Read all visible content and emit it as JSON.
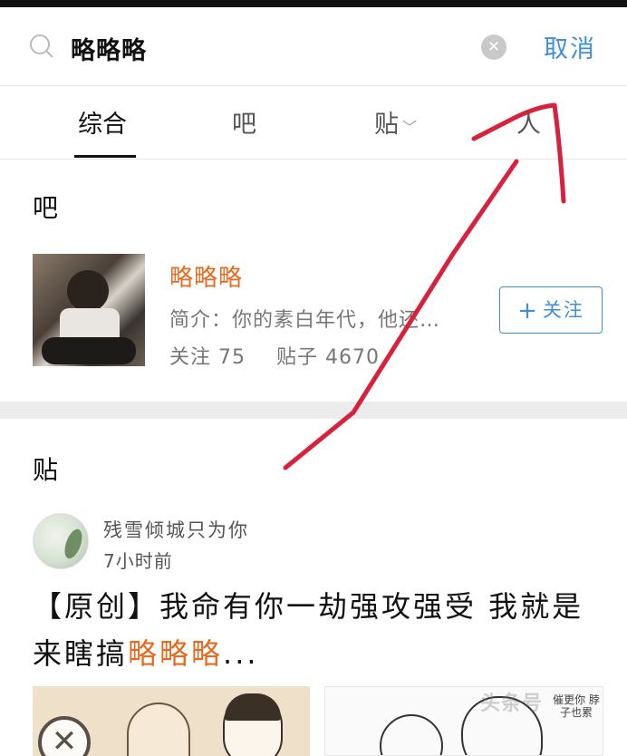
{
  "search": {
    "query": "略略略",
    "cancel_label": "取消"
  },
  "tabs": [
    {
      "label": "综合",
      "active": true
    },
    {
      "label": "吧",
      "active": false
    },
    {
      "label": "贴",
      "active": false
    },
    {
      "label": "人",
      "active": false
    }
  ],
  "ba_section": {
    "title": "吧",
    "forum": {
      "name": "略略略",
      "intro": "简介：你的素白年代，他还…",
      "followers_label": "关注 75",
      "posts_label": "贴子 4670",
      "follow_button": "关注"
    }
  },
  "post_section": {
    "title": "贴",
    "post": {
      "author": "残雪倾城只为你",
      "time": "7小时前",
      "title_prefix": "【原创】我命有你一劫强攻强受 我就是来瞎搞",
      "title_highlight": "略略略",
      "title_suffix": "...",
      "thumb2_caption": "催更你 脖子也累"
    }
  },
  "watermark": "头条号",
  "colors": {
    "accent_blue": "#3d8fdb",
    "highlight_orange": "#e56a1f",
    "annotation_red": "#d8213c"
  },
  "icons": [
    "search-icon",
    "clear-icon",
    "chevron-down-icon",
    "plus-icon",
    "close-icon"
  ]
}
